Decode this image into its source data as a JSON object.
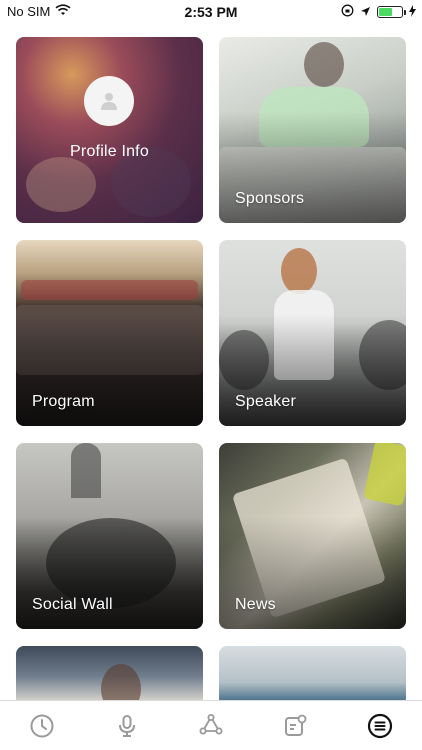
{
  "status_bar": {
    "carrier": "No SIM",
    "time": "2:53 PM",
    "icons": [
      "wifi-icon",
      "location-icon",
      "battery-icon",
      "charging-icon"
    ],
    "battery_level": 0.6
  },
  "cards": [
    {
      "label": "Profile Info",
      "icon": "user-icon"
    },
    {
      "label": "Sponsors"
    },
    {
      "label": "Program"
    },
    {
      "label": "Speaker"
    },
    {
      "label": "Social Wall"
    },
    {
      "label": "News"
    }
  ],
  "tab_bar": {
    "tabs": [
      {
        "icon": "clock-icon"
      },
      {
        "icon": "microphone-icon"
      },
      {
        "icon": "network-icon"
      },
      {
        "icon": "notification-icon"
      },
      {
        "icon": "menu-icon",
        "active": true
      }
    ]
  },
  "colors": {
    "background": "#ffffff",
    "text_on_image": "#ffffff",
    "tab_icon": "#9a9a9a",
    "tab_icon_active": "#111111",
    "battery": "#4cd964"
  }
}
